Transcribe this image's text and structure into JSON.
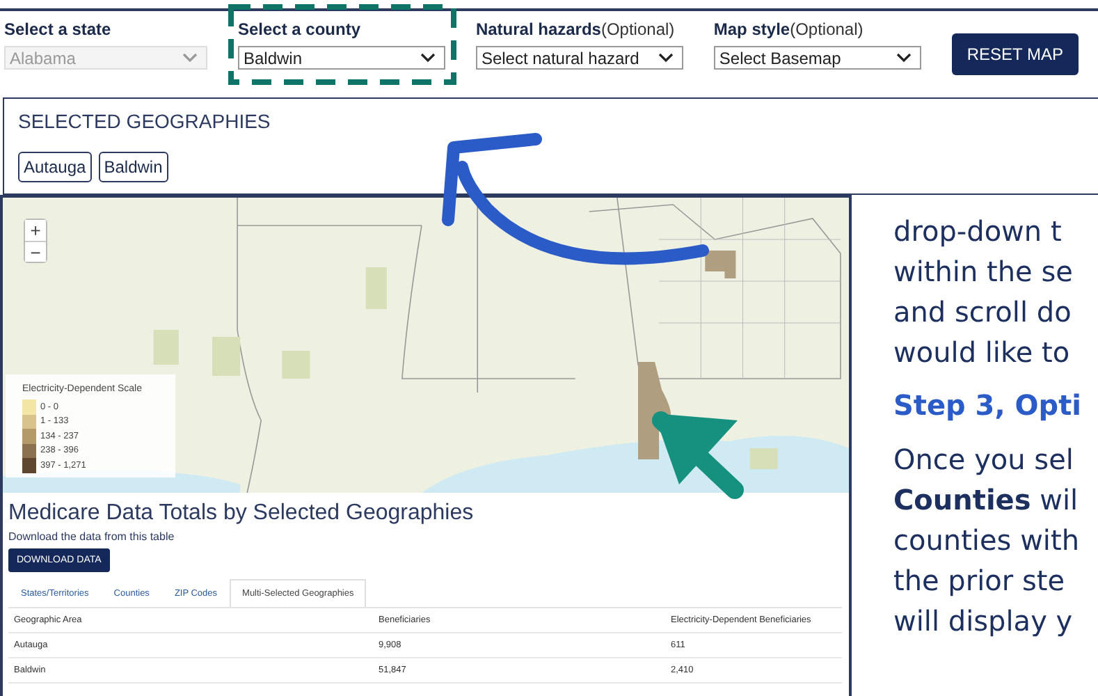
{
  "filters": [
    {
      "label": "Select a state",
      "value": "Alabama",
      "disabled": true
    },
    {
      "label": "Select a county",
      "value": "Baldwin",
      "disabled": false
    },
    {
      "label": "Natural hazards",
      "hint": "(Optional)",
      "value": "Select natural hazard",
      "disabled": false
    },
    {
      "label": "Map style",
      "hint": "(Optional)",
      "value": "Select Basemap",
      "disabled": false
    }
  ],
  "reset_button": "RESET MAP",
  "selected_geographies": {
    "title": "SELECTED GEOGRAPHIES",
    "chips": [
      "Autauga",
      "Baldwin"
    ]
  },
  "map": {
    "zoom_in": "+",
    "zoom_out": "−",
    "legend": {
      "title": "Electricity-Dependent Scale",
      "items": [
        {
          "label": "0 - 0",
          "color": "#f3e6a4"
        },
        {
          "label": "1 - 133",
          "color": "#d8c48a"
        },
        {
          "label": "134 - 237",
          "color": "#b39a68"
        },
        {
          "label": "238 - 396",
          "color": "#8c7150"
        },
        {
          "label": "397 - 1,271",
          "color": "#5e4630"
        }
      ]
    }
  },
  "data_section": {
    "title": "Medicare Data Totals by Selected Geographies",
    "subtitle": "Download the data from this table",
    "download_button": "DOWNLOAD DATA",
    "tabs": [
      {
        "label": "States/Territories",
        "selected": false
      },
      {
        "label": "Counties",
        "selected": false
      },
      {
        "label": "ZIP Codes",
        "selected": false
      },
      {
        "label": "Multi-Selected Geographies",
        "selected": true
      }
    ],
    "table": {
      "columns": [
        "Geographic Area",
        "Beneficiaries",
        "Electricity-Dependent Beneficiaries"
      ],
      "rows": [
        [
          "Autauga",
          "9,908",
          "611"
        ],
        [
          "Baldwin",
          "51,847",
          "2,410"
        ]
      ]
    }
  },
  "instructions": {
    "paragraph_1": [
      "drop-down t",
      "within the se",
      "and scroll do",
      "would like to"
    ],
    "heading": "Step 3, Opti",
    "paragraph_2": [
      "Once you sel",
      "**Counties** wil",
      "counties with",
      "the prior ste",
      "will display y"
    ]
  }
}
